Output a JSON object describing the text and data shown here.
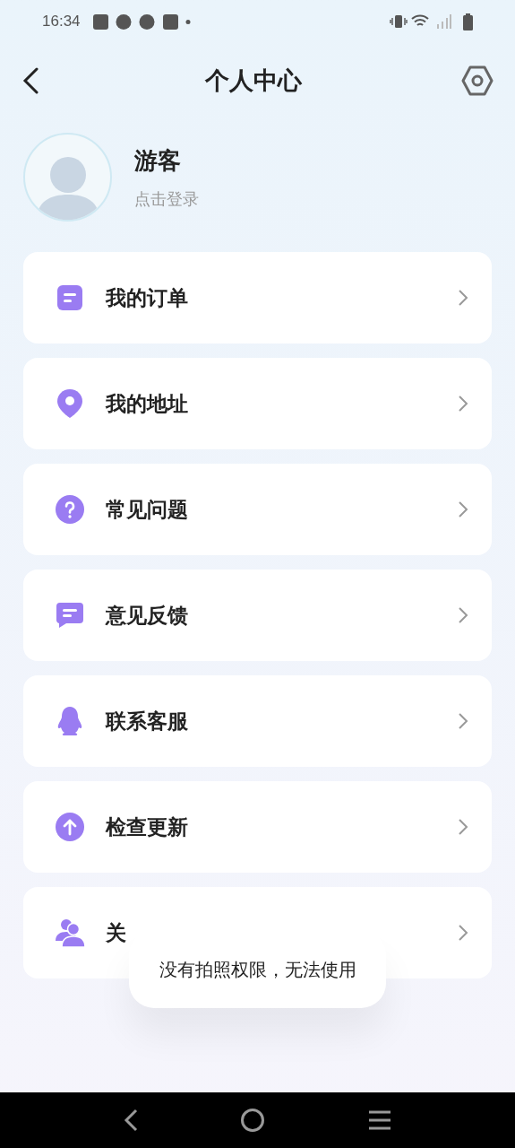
{
  "status_bar": {
    "time": "16:34"
  },
  "header": {
    "title": "个人中心"
  },
  "profile": {
    "name": "游客",
    "subtitle": "点击登录"
  },
  "menu": [
    {
      "label": "我的订单"
    },
    {
      "label": "我的地址"
    },
    {
      "label": "常见问题"
    },
    {
      "label": "意见反馈"
    },
    {
      "label": "联系客服"
    },
    {
      "label": "检查更新"
    },
    {
      "label": "关"
    }
  ],
  "toast": {
    "text": "没有拍照权限，无法使用"
  }
}
